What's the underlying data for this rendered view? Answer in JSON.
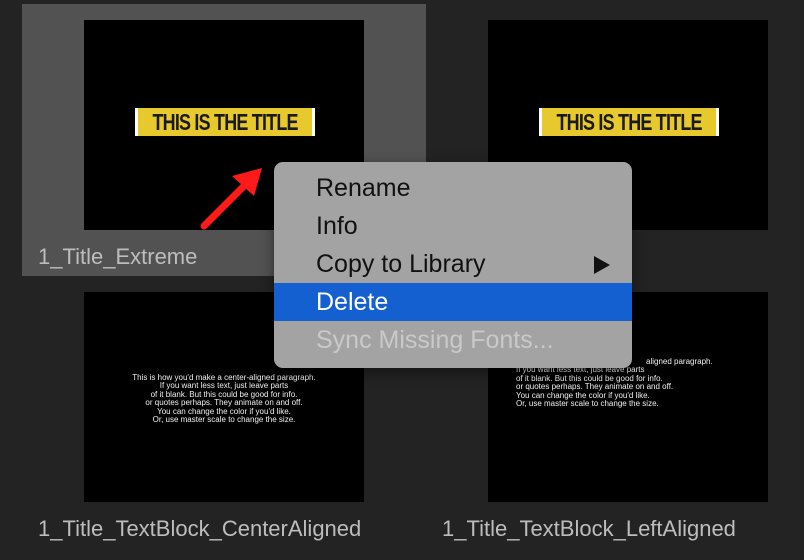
{
  "thumbnails": [
    {
      "caption": "1_Title_Extreme",
      "badge_text": "THIS IS THE TITLE",
      "selected": true
    },
    {
      "caption": "",
      "badge_text": "THIS IS THE TITLE",
      "selected": false
    },
    {
      "caption": "1_Title_TextBlock_CenterAligned",
      "paragraph": [
        "This is how you'd make a center-aligned paragraph.",
        "If you want less text, just leave parts",
        "of it blank. But this could be good for info.",
        "or quotes perhaps. They animate on and off.",
        "You can change the color if you'd like.",
        "Or, use master scale to change the size."
      ]
    },
    {
      "caption": "1_Title_TextBlock_LeftAligned",
      "paragraph": [
        "aligned paragraph.",
        "If you want less text, just leave parts",
        "of it blank. But this could be good for info.",
        "or quotes perhaps. They animate on and off.",
        "You can change the color if you'd like.",
        "Or, use master scale to change the size."
      ]
    }
  ],
  "context_menu": {
    "items": [
      {
        "label": "Rename",
        "state": "normal"
      },
      {
        "label": "Info",
        "state": "normal"
      },
      {
        "label": "Copy to Library",
        "state": "normal",
        "submenu": true
      },
      {
        "label": "Delete",
        "state": "highlighted"
      },
      {
        "label": "Sync Missing Fonts...",
        "state": "disabled"
      }
    ]
  },
  "colors": {
    "background": "#232323",
    "selected_tile": "#525252",
    "badge": "#e8c92d",
    "menu_bg": "#a3a3a3",
    "menu_highlight": "#1560d0",
    "annotation_arrow": "#ff1a1a"
  },
  "icons": {
    "submenu": "triangle-right-icon",
    "annotation": "red-arrow-icon"
  }
}
